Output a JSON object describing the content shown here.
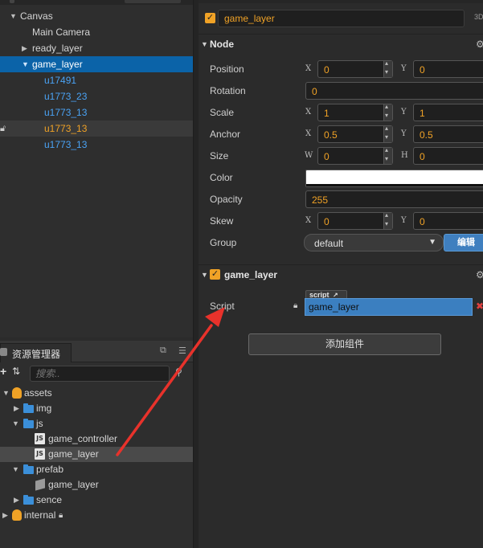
{
  "hierarchy": {
    "items": [
      {
        "label": "Canvas"
      },
      {
        "label": "Main Camera"
      },
      {
        "label": "ready_layer"
      },
      {
        "label": "game_layer"
      },
      {
        "label": "u17491"
      },
      {
        "label": "u1773_23"
      },
      {
        "label": "u1773_13"
      },
      {
        "label": "u1773_13"
      },
      {
        "label": "u1773_13"
      }
    ]
  },
  "assets": {
    "tab_label": "资源管理器",
    "search_placeholder": "搜索..",
    "items": [
      {
        "label": "assets"
      },
      {
        "label": "img"
      },
      {
        "label": "js"
      },
      {
        "label": "game_controller"
      },
      {
        "label": "game_layer"
      },
      {
        "label": "prefab"
      },
      {
        "label": "game_layer"
      },
      {
        "label": "sence"
      },
      {
        "label": "internal"
      }
    ]
  },
  "inspector": {
    "node_name": "game_layer",
    "mode_label": "3D",
    "node_section": "Node",
    "props": {
      "position": {
        "label": "Position",
        "x_axis": "X",
        "y_axis": "Y",
        "x": "0",
        "y": "0"
      },
      "rotation": {
        "label": "Rotation",
        "value": "0"
      },
      "scale": {
        "label": "Scale",
        "x_axis": "X",
        "y_axis": "Y",
        "x": "1",
        "y": "1"
      },
      "anchor": {
        "label": "Anchor",
        "x_axis": "X",
        "y_axis": "Y",
        "x": "0.5",
        "y": "0.5"
      },
      "size": {
        "label": "Size",
        "w_axis": "W",
        "h_axis": "H",
        "w": "0",
        "h": "0"
      },
      "color": {
        "label": "Color",
        "value_hex": "#ffffff"
      },
      "opacity": {
        "label": "Opacity",
        "value": "255"
      },
      "skew": {
        "label": "Skew",
        "x_axis": "X",
        "y_axis": "Y",
        "x": "0",
        "y": "0"
      },
      "group": {
        "label": "Group",
        "value": "default",
        "edit_label": "编辑"
      }
    },
    "component": {
      "title": "game_layer",
      "script_label": "Script",
      "script_tag": "script",
      "script_value": "game_layer"
    },
    "add_component_label": "添加组件"
  },
  "colors": {
    "accent_orange": "#f0a226",
    "selection_blue": "#0b63a8",
    "prefab_blue": "#4aa3f5",
    "annotation_red": "#e8322b"
  }
}
